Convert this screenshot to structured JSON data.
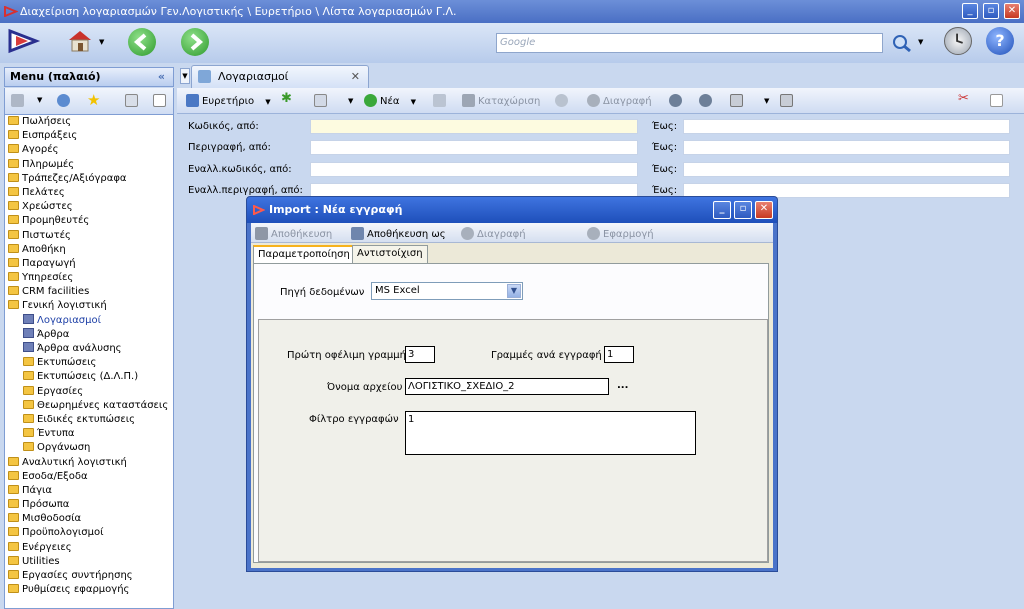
{
  "window": {
    "title": "Διαχείριση λογαριασμών Γεν.Λογιστικής \\ Ευρετήριο \\ Λίστα λογαριασμών Γ.Λ."
  },
  "search": {
    "placeholder": "Google"
  },
  "menu": {
    "title": "Menu (παλαιό)",
    "items": [
      {
        "label": "Πωλήσεις",
        "icon": "folder-icon",
        "level": 0
      },
      {
        "label": "Εισπράξεις",
        "icon": "folder-icon",
        "level": 0
      },
      {
        "label": "Αγορές",
        "icon": "folder-icon",
        "level": 0
      },
      {
        "label": "Πληρωμές",
        "icon": "folder-icon",
        "level": 0
      },
      {
        "label": "Τράπεζες/Αξιόγραφα",
        "icon": "folder-icon",
        "level": 0
      },
      {
        "label": "Πελάτες",
        "icon": "folder-icon",
        "level": 0
      },
      {
        "label": "Χρεώστες",
        "icon": "folder-icon",
        "level": 0
      },
      {
        "label": "Προμηθευτές",
        "icon": "folder-icon",
        "level": 0
      },
      {
        "label": "Πιστωτές",
        "icon": "folder-icon",
        "level": 0
      },
      {
        "label": "Αποθήκη",
        "icon": "folder-icon",
        "level": 0
      },
      {
        "label": "Παραγωγή",
        "icon": "folder-icon",
        "level": 0
      },
      {
        "label": "Υπηρεσίες",
        "icon": "folder-icon",
        "level": 0
      },
      {
        "label": "CRM facilities",
        "icon": "folder-icon",
        "level": 0
      },
      {
        "label": "Γενική λογιστική",
        "icon": "folder-icon",
        "level": 0
      },
      {
        "label": "Λογαριασμοί",
        "icon": "cube-icon",
        "level": 1,
        "selected": true
      },
      {
        "label": "Άρθρα",
        "icon": "cube-icon",
        "level": 1
      },
      {
        "label": "Άρθρα ανάλυσης",
        "icon": "cube-icon",
        "level": 1
      },
      {
        "label": "Εκτυπώσεις",
        "icon": "folder-icon",
        "level": 1
      },
      {
        "label": "Εκτυπώσεις (Δ.Λ.Π.)",
        "icon": "folder-icon",
        "level": 1
      },
      {
        "label": "Εργασίες",
        "icon": "folder-icon",
        "level": 1
      },
      {
        "label": "Θεωρημένες καταστάσεις",
        "icon": "folder-icon",
        "level": 1
      },
      {
        "label": "Ειδικές εκτυπώσεις",
        "icon": "folder-icon",
        "level": 1
      },
      {
        "label": "Έντυπα",
        "icon": "folder-icon",
        "level": 1
      },
      {
        "label": "Οργάνωση",
        "icon": "folder-icon",
        "level": 1
      },
      {
        "label": "Αναλυτική λογιστική",
        "icon": "folder-icon",
        "level": 0
      },
      {
        "label": "Εσοδα/Εξοδα",
        "icon": "folder-icon",
        "level": 0
      },
      {
        "label": "Πάγια",
        "icon": "folder-icon",
        "level": 0
      },
      {
        "label": "Πρόσωπα",
        "icon": "folder-icon",
        "level": 0
      },
      {
        "label": "Μισθοδοσία",
        "icon": "folder-icon",
        "level": 0
      },
      {
        "label": "Προϋπολογισμοί",
        "icon": "folder-icon",
        "level": 0
      },
      {
        "label": "Ενέργειες",
        "icon": "folder-icon",
        "level": 0
      },
      {
        "label": "Utilities",
        "icon": "folder-icon",
        "level": 0
      },
      {
        "label": "Εργασίες συντήρησης",
        "icon": "folder-icon",
        "level": 0
      },
      {
        "label": "Ρυθμίσεις εφαρμογής",
        "icon": "folder-icon",
        "level": 0
      }
    ]
  },
  "doc_tab": {
    "label": "Λογαριασμοί"
  },
  "toolbar": {
    "index_label": "Ευρετήριο",
    "new_label": "Νέα",
    "post_label": "Καταχώριση",
    "delete_label": "Διαγραφή"
  },
  "filters": {
    "code_from": "Κωδικός, από:",
    "desc_from": "Περιγραφή, από:",
    "altcode_from": "Εναλλ.κωδικός, από:",
    "altdesc_from": "Εναλλ.περιγραφή, από:",
    "to": "Έως:"
  },
  "dialog": {
    "title": "Import : Νέα εγγραφή",
    "toolbar": {
      "save": "Αποθήκευση",
      "save_as": "Αποθήκευση ως",
      "delete": "Διαγραφή",
      "apply": "Εφαρμογή"
    },
    "tabs": [
      "Παραμετροποίηση",
      "Αντιστοίχιση"
    ],
    "source_label": "Πηγή δεδομένων",
    "source_value": "MS Excel",
    "first_row_label": "Πρώτη οφέλιμη γραμμή",
    "first_row_value": "3",
    "rows_per_record_label": "Γραμμές ανά εγγραφή",
    "rows_per_record_value": "1",
    "filename_label": "Όνομα αρχείου",
    "filename_value": "ΛΟΓΙΣΤΙΚΟ_ΣΧΕΔΙΟ_2",
    "browse_label": "...",
    "filter_label": "Φίλτρο εγγραφών",
    "filter_value": "1"
  }
}
